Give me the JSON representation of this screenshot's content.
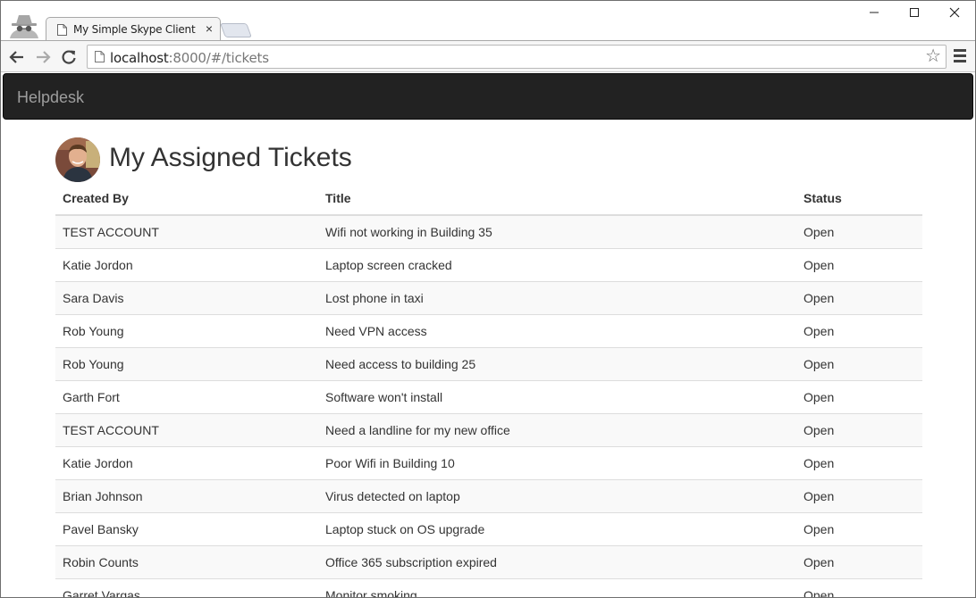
{
  "browser": {
    "tab_title": "My Simple Skype Client",
    "tab_close": "×",
    "url_host": "localhost",
    "url_path": ":8000/#/tickets",
    "window_controls": {
      "minimize": "—",
      "maximize": "☐",
      "close": "✕"
    },
    "bookmark_star": "☆"
  },
  "navbar": {
    "brand": "Helpdesk"
  },
  "header": {
    "title": "My Assigned Tickets"
  },
  "table": {
    "headers": {
      "created_by": "Created By",
      "title": "Title",
      "status": "Status"
    },
    "rows": [
      {
        "created_by": "TEST ACCOUNT",
        "title": "Wifi not working in Building 35",
        "status": "Open"
      },
      {
        "created_by": "Katie Jordon",
        "title": "Laptop screen cracked",
        "status": "Open"
      },
      {
        "created_by": "Sara Davis",
        "title": "Lost phone in taxi",
        "status": "Open"
      },
      {
        "created_by": "Rob Young",
        "title": "Need VPN access",
        "status": "Open"
      },
      {
        "created_by": "Rob Young",
        "title": "Need access to building 25",
        "status": "Open"
      },
      {
        "created_by": "Garth Fort",
        "title": "Software won't install",
        "status": "Open"
      },
      {
        "created_by": "TEST ACCOUNT",
        "title": "Need a landline for my new office",
        "status": "Open"
      },
      {
        "created_by": "Katie Jordon",
        "title": "Poor Wifi in Building 10",
        "status": "Open"
      },
      {
        "created_by": "Brian Johnson",
        "title": "Virus detected on laptop",
        "status": "Open"
      },
      {
        "created_by": "Pavel Bansky",
        "title": "Laptop stuck on OS upgrade",
        "status": "Open"
      },
      {
        "created_by": "Robin Counts",
        "title": "Office 365 subscription expired",
        "status": "Open"
      },
      {
        "created_by": "Garret Vargas",
        "title": "Monitor smoking",
        "status": "Open"
      }
    ]
  },
  "colors": {
    "navbar_bg": "#222222",
    "brand_text": "#9d9d9d",
    "stripe": "#f9f9f9",
    "border": "#dddddd"
  },
  "icons": [
    "incognito-icon",
    "page-icon",
    "back-arrow-icon",
    "forward-arrow-icon",
    "reload-icon",
    "star-icon",
    "menu-icon",
    "avatar"
  ]
}
